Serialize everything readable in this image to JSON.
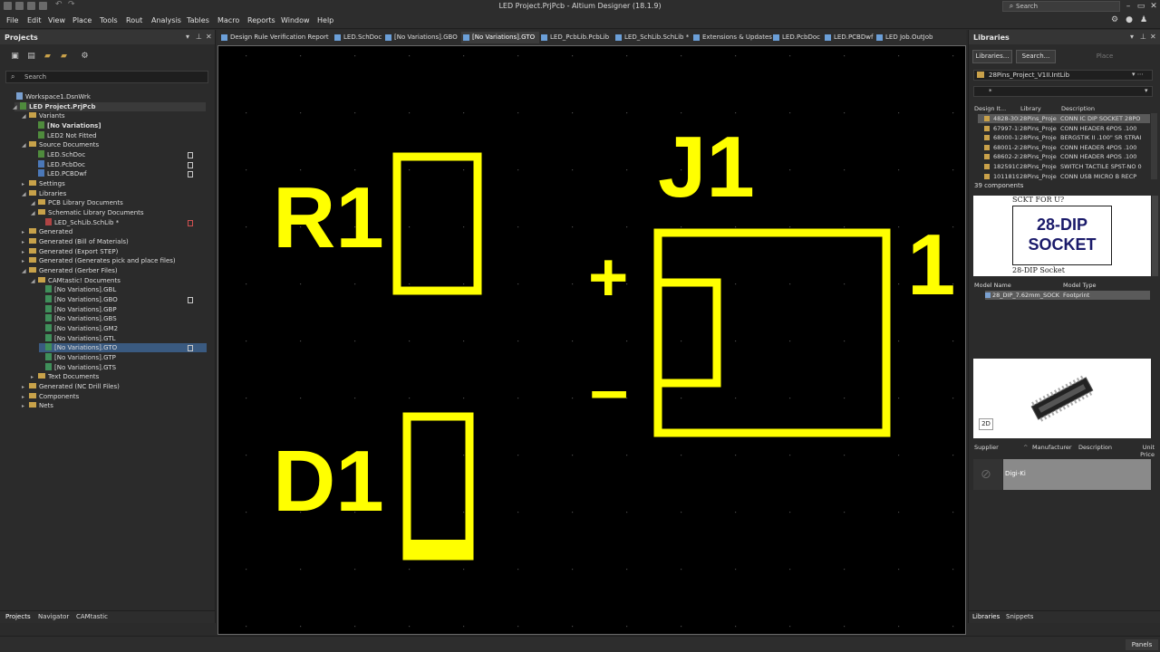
{
  "window": {
    "title": "LED Project.PrjPcb - Altium Designer (18.1.9)",
    "search_placeholder": "Search"
  },
  "menu": [
    "File",
    "Edit",
    "View",
    "Place",
    "Tools",
    "Rout",
    "Analysis",
    "Tables",
    "Macro",
    "Reports",
    "Window",
    "Help"
  ],
  "projects_panel": {
    "title": "Projects",
    "search_placeholder": "Search",
    "tree": [
      {
        "label": "Workspace1.DsnWrk",
        "level": 0,
        "icon": "ws"
      },
      {
        "label": "LED Project.PrjPcb",
        "level": 1,
        "icon": "doc",
        "bold": true,
        "selected": true
      },
      {
        "label": "Variants",
        "level": 2,
        "icon": "folder"
      },
      {
        "label": "[No Variations]",
        "level": 3,
        "icon": "variant",
        "bold": true
      },
      {
        "label": "LED2 Not Fitted",
        "level": 3,
        "icon": "variant"
      },
      {
        "label": "Source Documents",
        "level": 2,
        "icon": "folder"
      },
      {
        "label": "LED.SchDoc",
        "level": 3,
        "icon": "sch",
        "mark": "doc"
      },
      {
        "label": "LED.PcbDoc",
        "level": 3,
        "icon": "pcb",
        "mark": "doc"
      },
      {
        "label": "LED.PCBDwf",
        "level": 3,
        "icon": "pcb",
        "mark": "doc"
      },
      {
        "label": "Settings",
        "level": 2,
        "icon": "folder"
      },
      {
        "label": "Libraries",
        "level": 2,
        "icon": "folder"
      },
      {
        "label": "PCB Library Documents",
        "level": 3,
        "icon": "folder"
      },
      {
        "label": "Schematic Library Documents",
        "level": 3,
        "icon": "folder"
      },
      {
        "label": "LED_SchLib.SchLib *",
        "level": 4,
        "icon": "schlib",
        "mark": "red"
      },
      {
        "label": "Generated",
        "level": 2,
        "icon": "folder"
      },
      {
        "label": "Generated (Bill of Materials)",
        "level": 2,
        "icon": "folder"
      },
      {
        "label": "Generated (Export STEP)",
        "level": 2,
        "icon": "folder"
      },
      {
        "label": "Generated (Generates pick and place files)",
        "level": 2,
        "icon": "folder"
      },
      {
        "label": "Generated (Gerber Files)",
        "level": 2,
        "icon": "folder"
      },
      {
        "label": "CAMtastic! Documents",
        "level": 3,
        "icon": "folder"
      },
      {
        "label": "[No Variations].GBL",
        "level": 4,
        "icon": "grid"
      },
      {
        "label": "[No Variations].GBO",
        "level": 4,
        "icon": "grid",
        "mark": "doc"
      },
      {
        "label": "[No Variations].GBP",
        "level": 4,
        "icon": "grid"
      },
      {
        "label": "[No Variations].GBS",
        "level": 4,
        "icon": "grid"
      },
      {
        "label": "[No Variations].GM2",
        "level": 4,
        "icon": "grid"
      },
      {
        "label": "[No Variations].GTL",
        "level": 4,
        "icon": "grid"
      },
      {
        "label": "[No Variations].GTO",
        "level": 4,
        "icon": "grid",
        "mark": "doc",
        "highlight": true
      },
      {
        "label": "[No Variations].GTP",
        "level": 4,
        "icon": "grid"
      },
      {
        "label": "[No Variations].GTS",
        "level": 4,
        "icon": "grid"
      },
      {
        "label": "Text Documents",
        "level": 3,
        "icon": "folder"
      },
      {
        "label": "Generated (NC Drill Files)",
        "level": 2,
        "icon": "folder"
      },
      {
        "label": "Components",
        "level": 2,
        "icon": "folder"
      },
      {
        "label": "Nets",
        "level": 2,
        "icon": "folder"
      }
    ],
    "bottom_tabs": [
      "Projects",
      "Navigator",
      "CAMtastic"
    ]
  },
  "doc_tabs": [
    {
      "label": "Design Rule Verification Report",
      "width": 125
    },
    {
      "label": "LED.SchDoc",
      "width": 56
    },
    {
      "label": "[No Variations].GBO",
      "width": 86
    },
    {
      "label": "[No Variations].GTO",
      "width": 86,
      "active": true
    },
    {
      "label": "LED_PcbLib.PcbLib",
      "width": 82
    },
    {
      "label": "LED_SchLib.SchLib *",
      "width": 86
    },
    {
      "label": "Extensions & Updates",
      "width": 88
    },
    {
      "label": "LED.PcbDoc",
      "width": 57
    },
    {
      "label": "LED.PCBDwf",
      "width": 57
    },
    {
      "label": "LED Job.OutJob",
      "width": 66
    }
  ],
  "canvas": {
    "labels": {
      "r1": "R1",
      "d1": "D1",
      "j1": "J1",
      "pin1": "1",
      "plus": "+",
      "minus": "–"
    },
    "overlay_color": "#ffff00"
  },
  "libraries_panel": {
    "title": "Libraries",
    "buttons": {
      "libraries": "Libraries...",
      "search": "Search...",
      "place": "Place"
    },
    "library_name": "28Pins_Project_V1II.IntLib",
    "filter": "*",
    "columns": {
      "design_item": "Design It...",
      "library": "Library",
      "description": "Description"
    },
    "components": [
      {
        "id": "4828-30I",
        "lib": "28Pins_Proje",
        "desc": "CONN IC DIP SOCKET 28PO",
        "selected": true
      },
      {
        "id": "67997-1I",
        "lib": "28Pins_Proje",
        "desc": "CONN HEADER 6POS .100"
      },
      {
        "id": "68000-1I",
        "lib": "28Pins_Proje",
        "desc": "BERGSTIK II .100\" SR STRAI"
      },
      {
        "id": "68001-2I",
        "lib": "28Pins_Proje",
        "desc": "CONN HEADER 4POS .100"
      },
      {
        "id": "68602-2I",
        "lib": "28Pins_Proje",
        "desc": "CONN HEADER 4POS .100"
      },
      {
        "id": "1825910",
        "lib": "28Pins_Proje",
        "desc": "SWITCH TACTILE SPST-NO 0"
      },
      {
        "id": "1011819",
        "lib": "28Pins_Proje",
        "desc": "CONN USB MICRO B RECP"
      }
    ],
    "count": "39 components",
    "sch_preview": {
      "top": "SCKT FOR U?",
      "line1": "28-DIP",
      "line2": "SOCKET",
      "bottom": "28-DIP Socket"
    },
    "model_columns": {
      "name": "Model Name",
      "type": "Model Type"
    },
    "models": [
      {
        "name": "28_DIP_7.62mm_SOCK",
        "type": "Footprint"
      }
    ],
    "view_2d": "2D",
    "supplier_columns": {
      "supplier": "Supplier",
      "manufacturer": "Manufacturer",
      "description": "Description",
      "unit_price": "Unit Price"
    },
    "supplier": "Digi-Ki",
    "bottom_tabs": [
      "Libraries",
      "Snippets"
    ]
  },
  "status": {
    "panels": "Panels"
  }
}
